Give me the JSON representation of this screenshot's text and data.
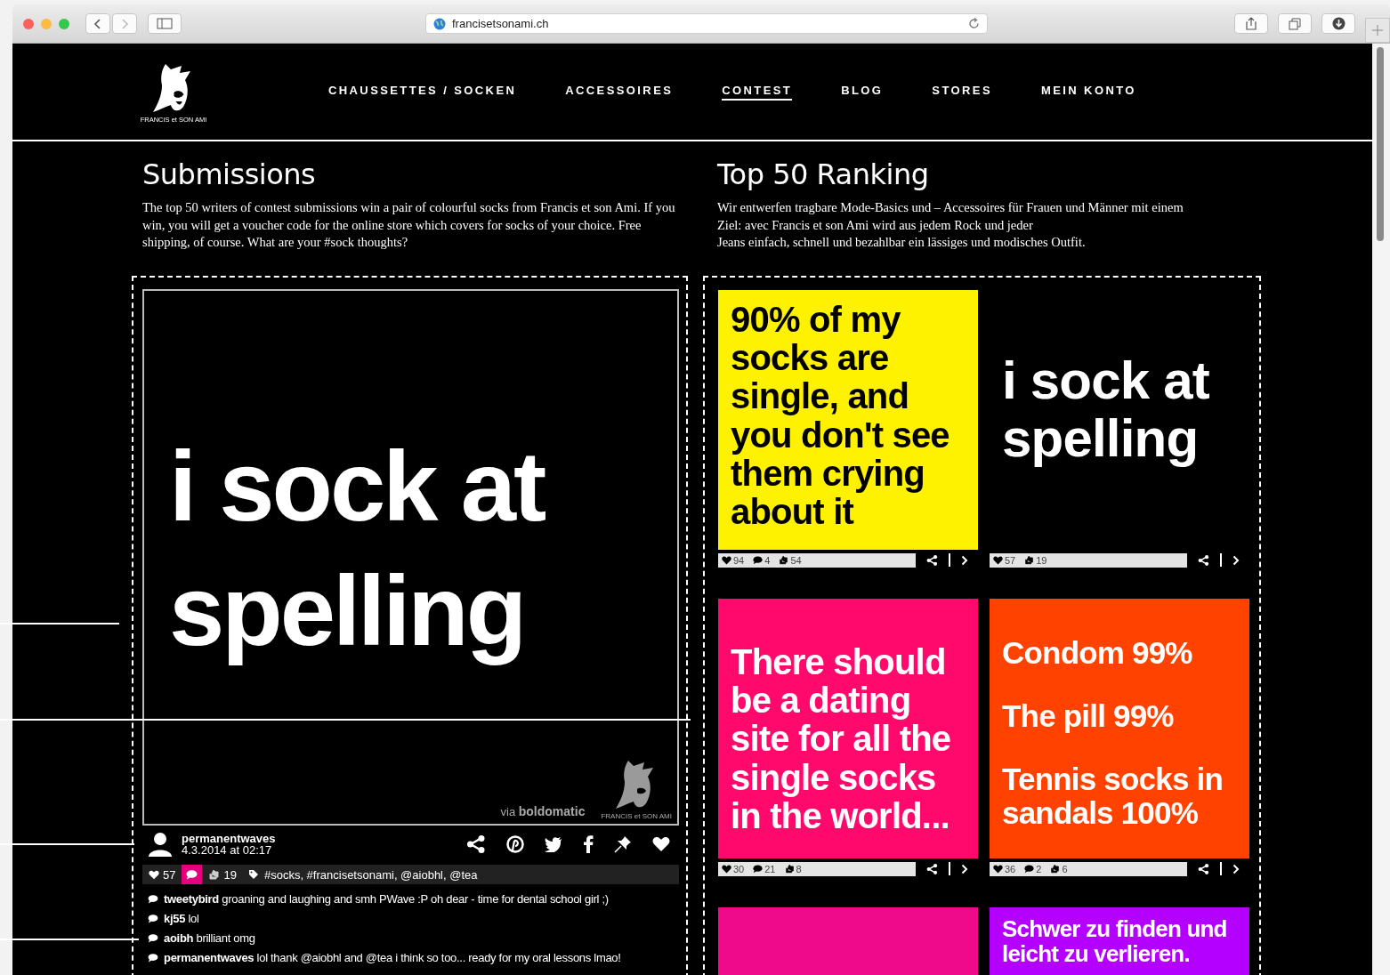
{
  "browser": {
    "url": "francisetsonami.ch"
  },
  "logo": {
    "text": "FRANCIS et SON AMI"
  },
  "nav": [
    {
      "label": "CHAUSSETTES / SOCKEN",
      "selected": false
    },
    {
      "label": "ACCESSOIRES",
      "selected": false
    },
    {
      "label": "CONTEST",
      "selected": true
    },
    {
      "label": "BLOG",
      "selected": false
    },
    {
      "label": "STORES",
      "selected": false
    },
    {
      "label": "MEIN KONTO",
      "selected": false
    }
  ],
  "submissions": {
    "title": "Submissions",
    "intro": "The top 50 writers of contest submissions win a pair of colourful socks from Francis et son Ami. If you win, you will get a voucher code for the online store which covers for socks of your choice. Free shipping, of course. What are your #sock thoughts?",
    "featured": {
      "text": "i sock at spelling",
      "credit_prefix": "via",
      "credit": "boldomatic",
      "logo_text": "FRANCIS et SON AMI"
    },
    "author": {
      "name": "permanentwaves",
      "date": "4.3.2014 at 02:17"
    },
    "stats": [
      {
        "kind": "likes",
        "value": "57",
        "selected": false
      },
      {
        "kind": "comments",
        "selected": true
      },
      {
        "kind": "shares",
        "value": "19",
        "selected": false
      }
    ],
    "tags": "#socks, #francisetsonami, @aiobhl, @tea",
    "comments": [
      {
        "user": "tweetybird",
        "text": "groaning and laughing and smh PWave :P oh dear - time for dental school girl ;)"
      },
      {
        "user": "kj55",
        "text": "lol"
      },
      {
        "user": "aoibh",
        "text": "brilliant omg"
      },
      {
        "user": "permanentwaves",
        "text": "lol thank @aiobhl and @tea i think so too... ready for my oral lessons lmao!"
      }
    ]
  },
  "ranking": {
    "title": "Top 50 Ranking",
    "intro_lines": [
      "Wir entwerfen tragbare Mode-Basics und – Accessoires für Frauen und Männer mit einem",
      "Ziel: avec Francis et son Ami wird aus jedem Rock und jeder",
      "Jeans einfach, schnell und bezahlbar ein lässiges und modisches Outfit."
    ],
    "cards": [
      {
        "color": "#fff200",
        "dark_text": true,
        "lines": [
          "90% of my socks are single, and you don't see them crying about it"
        ],
        "likes": "94",
        "comments": "4",
        "shares": "54"
      },
      {
        "color": "#000000",
        "dark_text": false,
        "lines": [
          "i sock at spelling"
        ],
        "likes": "57",
        "shares": "19"
      },
      {
        "color": "#ff0a6c",
        "dark_text": false,
        "lines": [
          "There should be a dating site for all the single socks in the world..."
        ],
        "likes": "30",
        "comments": "21",
        "shares": "8"
      },
      {
        "color": "#ff4200",
        "dark_text": false,
        "lines": [
          "Condom 99%",
          "The pill 99%",
          "Tennis socks in sandals 100%"
        ],
        "likes": "36",
        "comments": "2",
        "shares": "6"
      },
      {
        "color": "#ee0a8a"
      },
      {
        "color": "#b400ff",
        "dark_text": false,
        "lines": [
          "Schwer zu finden und leicht zu verlieren."
        ]
      }
    ]
  }
}
